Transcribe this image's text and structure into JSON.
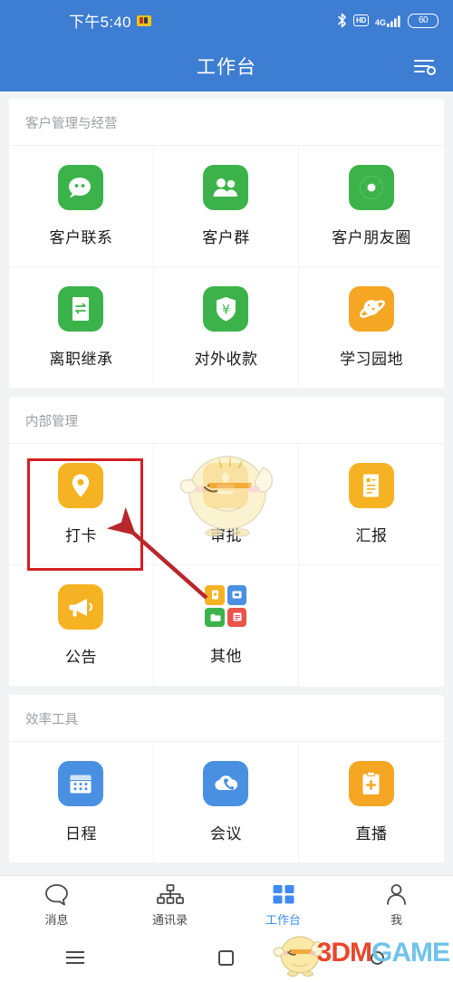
{
  "status_bar": {
    "time": "下午5:40",
    "icons": [
      "app-badge-icon",
      "bluetooth-icon",
      "hd-icon",
      "4g-icon",
      "signal-icon",
      "battery-icon"
    ],
    "hd_label": "HD",
    "network_label": "4G",
    "battery_level": "60"
  },
  "header": {
    "title": "工作台",
    "action_icon": "filter-settings-icon",
    "background": "#3d7dd2"
  },
  "sections": [
    {
      "title": "客户管理与经营",
      "items": [
        {
          "label": "客户联系",
          "icon": "chat-bubble-icon",
          "color": "#3cb34a"
        },
        {
          "label": "客户群",
          "icon": "group-people-icon",
          "color": "#3cb34a"
        },
        {
          "label": "客户朋友圈",
          "icon": "camera-aperture-icon",
          "color": "#3cb34a"
        },
        {
          "label": "离职继承",
          "icon": "transfer-doc-icon",
          "color": "#3cb34a"
        },
        {
          "label": "对外收款",
          "icon": "shield-yuan-icon",
          "color": "#3cb34a"
        },
        {
          "label": "学习园地",
          "icon": "planet-saturn-icon",
          "color": "#f5a623"
        }
      ]
    },
    {
      "title": "内部管理",
      "items": [
        {
          "label": "打卡",
          "icon": "location-pin-icon",
          "color": "#f5b324",
          "highlighted": true
        },
        {
          "label": "审批",
          "icon": "stamp-icon",
          "color": "#f5b324"
        },
        {
          "label": "汇报",
          "icon": "report-doc-icon",
          "color": "#f5b324"
        },
        {
          "label": "公告",
          "icon": "megaphone-icon",
          "color": "#f5b324"
        },
        {
          "label": "其他",
          "icon": "app-tiles-icon",
          "color": "multi"
        }
      ]
    },
    {
      "title": "效率工具",
      "items": [
        {
          "label": "日程",
          "icon": "calendar-icon",
          "color": "#4a90e2"
        },
        {
          "label": "会议",
          "icon": "cloud-phone-icon",
          "color": "#4a90e2"
        },
        {
          "label": "直播",
          "icon": "clipboard-plus-icon",
          "color": "#f5a623"
        }
      ]
    }
  ],
  "annotation": {
    "highlight_color": "#d42020",
    "highlight_target": "打卡",
    "arrow_color": "#b8272c"
  },
  "tabbar": {
    "active": "工作台",
    "active_color": "#3d8bf2",
    "items": [
      {
        "label": "消息",
        "icon": "message-bubble-icon"
      },
      {
        "label": "通讯录",
        "icon": "org-tree-icon"
      },
      {
        "label": "工作台",
        "icon": "grid-squares-icon"
      },
      {
        "label": "我",
        "icon": "person-icon"
      }
    ]
  },
  "navbar": {
    "items": [
      {
        "icon": "menu-lines-icon"
      },
      {
        "icon": "home-square-icon"
      },
      {
        "icon": "back-circle-icon"
      }
    ]
  },
  "watermark": {
    "text_part1": "3DM",
    "text_part2": "GAME",
    "mascot": "duck-mascot-icon"
  }
}
